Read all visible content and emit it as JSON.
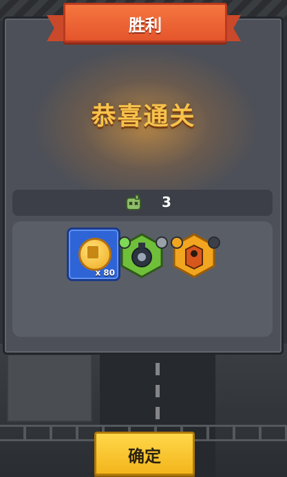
{
  "header": {
    "title": "胜利"
  },
  "main": {
    "congrats_text": "恭喜通关"
  },
  "kills": {
    "icon": "zombie-head-icon",
    "count": "3"
  },
  "rewards": [
    {
      "type": "coin",
      "icon": "gold-coin-icon",
      "quantity": "x 80",
      "frame_color": "#2f64d6"
    },
    {
      "type": "turret",
      "icon": "green-turret-icon",
      "frame_color": "#6fbf3a",
      "badges": [
        "heart-badge-icon",
        "gear-badge-icon"
      ]
    },
    {
      "type": "module",
      "icon": "orange-module-icon",
      "frame_color": "#f2a51f",
      "badges": [
        "sword-badge-icon",
        "chip-badge-icon"
      ]
    }
  ],
  "footer": {
    "confirm_label": "确定"
  },
  "colors": {
    "ribbon": "#e4552c",
    "title_gold": "#f7c24b",
    "confirm": "#f3b51c"
  }
}
